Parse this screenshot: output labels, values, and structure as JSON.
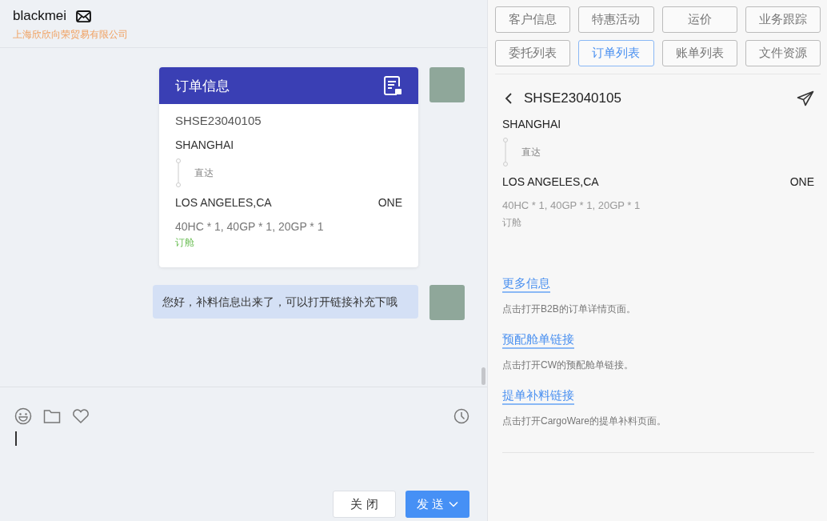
{
  "header": {
    "name": "blackmei",
    "company": "上海欣欣向荣贸易有限公司"
  },
  "messages": [
    {
      "kind": "order_card",
      "title": "订单信息",
      "order_no": "SHSE23040105",
      "origin": "SHANGHAI",
      "route_note": "直达",
      "destination": "LOS ANGELES,CA",
      "carrier": "ONE",
      "containers": "40HC * 1, 40GP * 1, 20GP * 1",
      "status": "订舱"
    },
    {
      "kind": "text",
      "text": "您好，补料信息出来了，可以打开链接补充下哦"
    }
  ],
  "composer": {
    "close_label": "关 闭",
    "send_label": "发 送"
  },
  "tabs": [
    {
      "label": "客户信息",
      "selected": false
    },
    {
      "label": "特惠活动",
      "selected": false
    },
    {
      "label": "运价",
      "selected": false
    },
    {
      "label": "业务跟踪",
      "selected": false
    },
    {
      "label": "委托列表",
      "selected": false
    },
    {
      "label": "订单列表",
      "selected": true
    },
    {
      "label": "账单列表",
      "selected": false
    },
    {
      "label": "文件资源",
      "selected": false
    }
  ],
  "order_detail": {
    "order_no": "SHSE23040105",
    "origin": "SHANGHAI",
    "route_note": "直达",
    "destination": "LOS ANGELES,CA",
    "carrier": "ONE",
    "containers": "40HC * 1, 40GP * 1, 20GP * 1",
    "status": "订舱"
  },
  "links": [
    {
      "label": "更多信息",
      "description": "点击打开B2B的订单详情页面。"
    },
    {
      "label": "预配舱单链接",
      "description": "点击打开CW的预配舱单链接。"
    },
    {
      "label": "提单补料链接",
      "description": "点击打开CargoWare的提单补料页面。"
    }
  ]
}
